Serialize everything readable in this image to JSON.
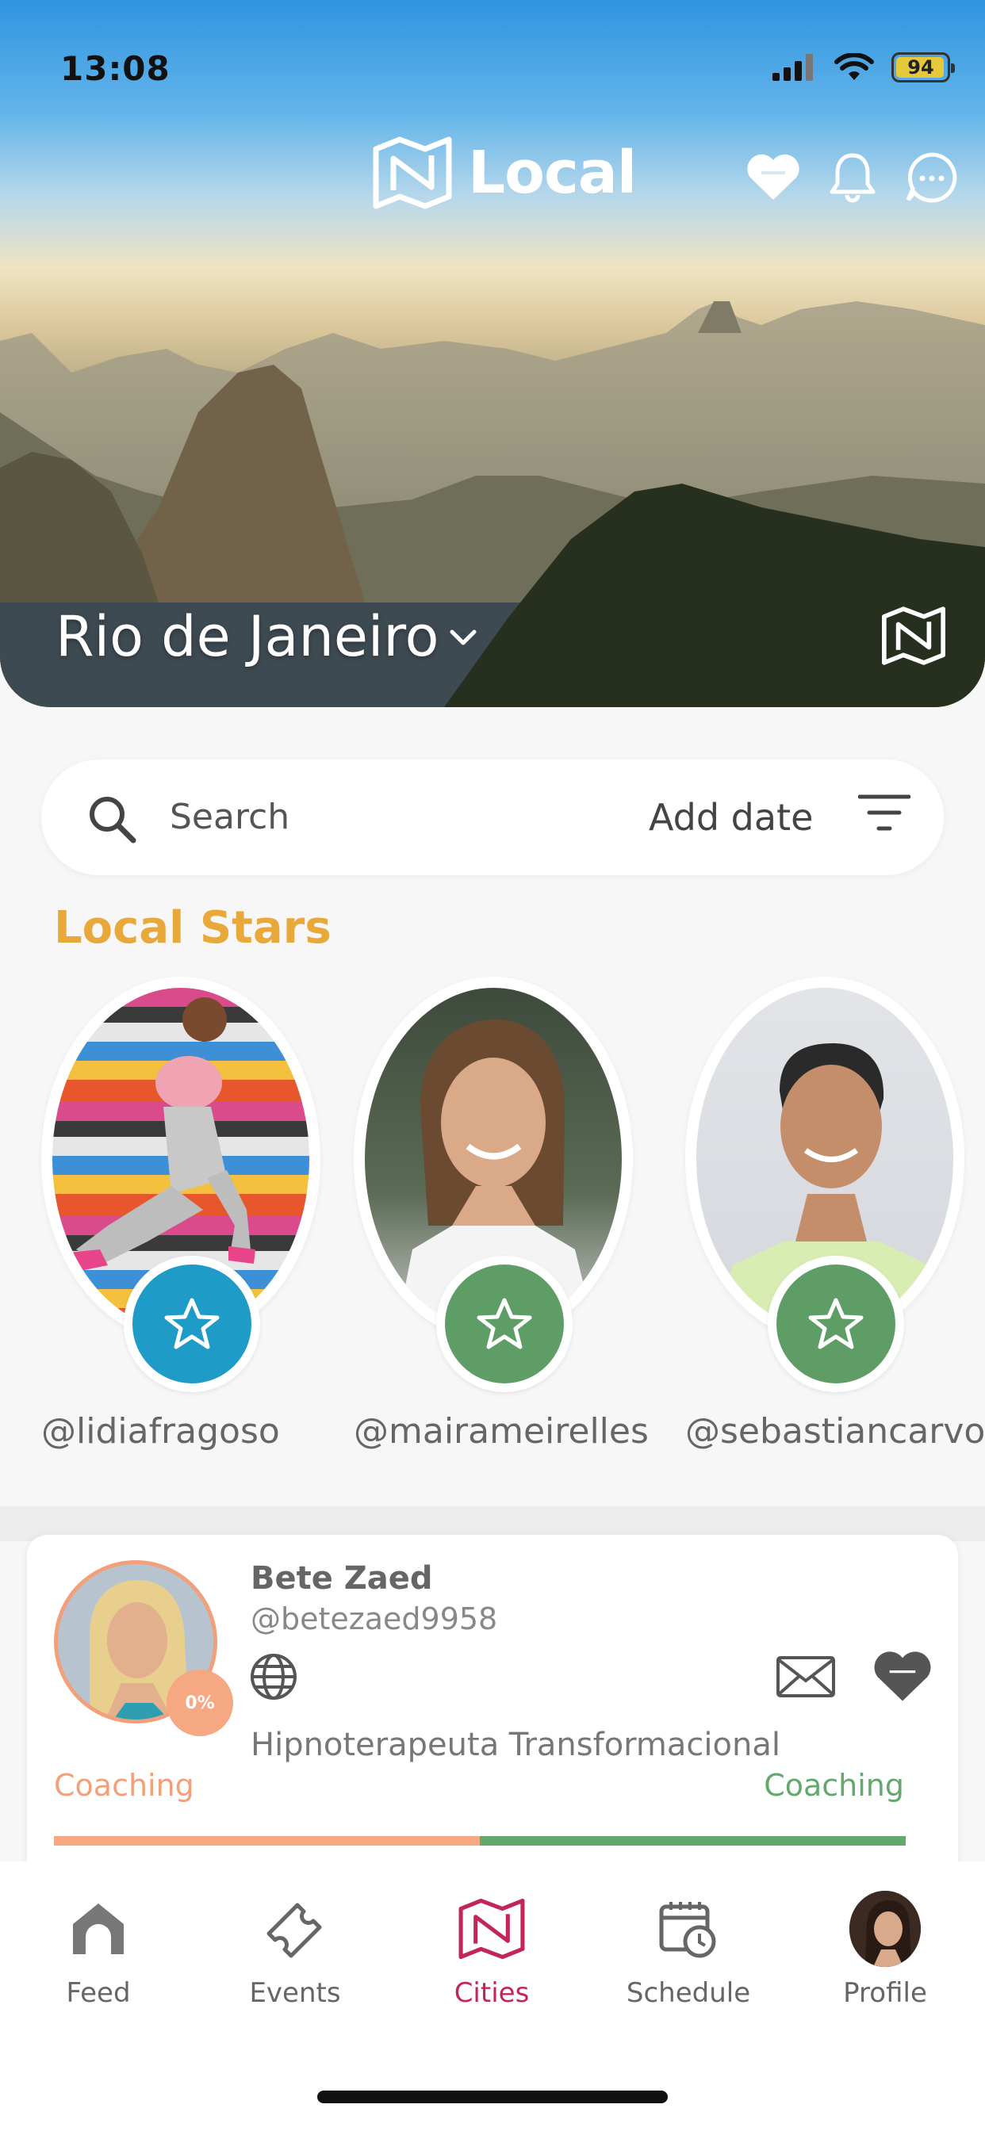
{
  "status_bar": {
    "time": "13:08",
    "battery": "94"
  },
  "header": {
    "app_name": "Local"
  },
  "hero": {
    "city": "Rio de Janeiro"
  },
  "search": {
    "placeholder": "Search",
    "add_date": "Add date"
  },
  "local_stars": {
    "title": "Local Stars",
    "items": [
      {
        "handle": "@lidiafragoso",
        "badge_color": "#1e9bc6"
      },
      {
        "handle": "@mairameirelles",
        "badge_color": "#5e9e66"
      },
      {
        "handle": "@sebastiancarvo",
        "badge_color": "#5e9e66"
      }
    ]
  },
  "profile_card": {
    "name": "Bete Zaed",
    "handle": "@betezaed9958",
    "progress_badge": "0%",
    "description": "Hipnoterapeuta Transformacional",
    "category_left": "Coaching",
    "category_right": "Coaching"
  },
  "tabs": [
    {
      "label": "Feed",
      "icon": "home-icon"
    },
    {
      "label": "Events",
      "icon": "ticket-icon"
    },
    {
      "label": "Cities",
      "icon": "map-icon",
      "active": true
    },
    {
      "label": "Schedule",
      "icon": "calendar-clock-icon"
    },
    {
      "label": "Profile",
      "icon": "avatar"
    }
  ],
  "colors": {
    "accent": "#c2255c",
    "gold": "#e8a83a",
    "peach": "#f6a882",
    "green": "#63a86c"
  }
}
